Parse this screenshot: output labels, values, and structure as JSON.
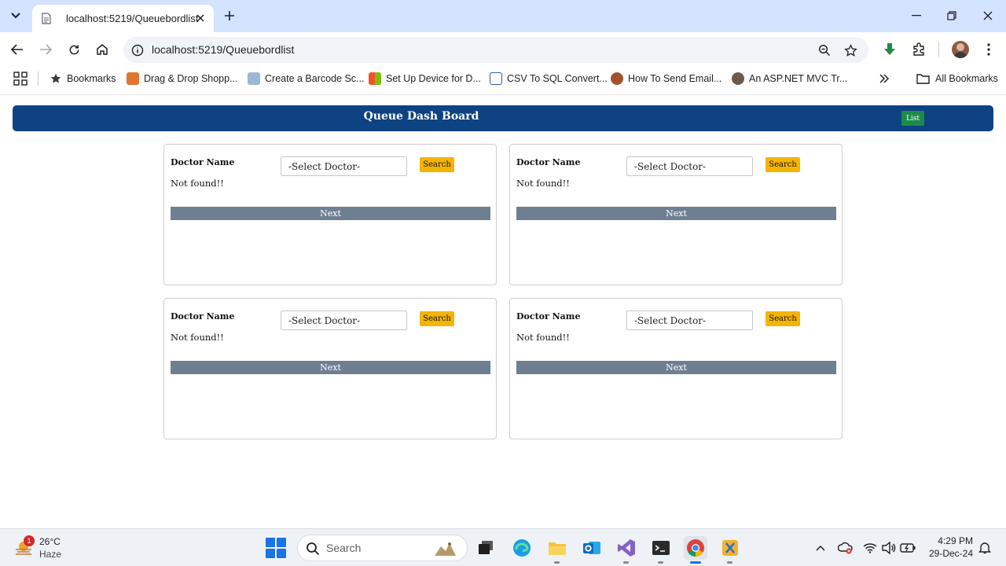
{
  "browser": {
    "tab_title": "localhost:5219/Queuebordlist",
    "url": "localhost:5219/Queuebordlist",
    "bookmarks_label": "Bookmarks",
    "bookmarks": [
      {
        "label": "Drag & Drop Shopp...",
        "color": "#e0752d"
      },
      {
        "label": "Create a Barcode Sc...",
        "color": "#9db7d8"
      },
      {
        "label": "Set Up Device for D...",
        "color": "#f35325"
      },
      {
        "label": "CSV To SQL Convert...",
        "color": "#2b5fb4"
      },
      {
        "label": "How To Send Email...",
        "color": "#a0522d"
      },
      {
        "label": "An ASP.NET MVC Tr...",
        "color": "#6d5a4a"
      }
    ],
    "all_bookmarks_label": "All Bookmarks"
  },
  "page": {
    "title": "Queue Dash Board",
    "list_button": "List",
    "colors": {
      "header": "#0d4382",
      "list_button": "#1e8a4a",
      "search_button": "#f4b400",
      "next_bar": "#6f7f92"
    },
    "cards": [
      {
        "label": "Doctor Name",
        "select_value": "-Select Doctor-",
        "search_label": "Search",
        "status": "Not found!!",
        "next_label": "Next"
      },
      {
        "label": "Doctor Name",
        "select_value": "-Select Doctor-",
        "search_label": "Search",
        "status": "Not found!!",
        "next_label": "Next"
      },
      {
        "label": "Doctor Name",
        "select_value": "-Select Doctor-",
        "search_label": "Search",
        "status": "Not found!!",
        "next_label": "Next"
      },
      {
        "label": "Doctor Name",
        "select_value": "-Select Doctor-",
        "search_label": "Search",
        "status": "Not found!!",
        "next_label": "Next"
      }
    ]
  },
  "taskbar": {
    "weather_temp": "26°C",
    "weather_desc": "Haze",
    "weather_badge": "1",
    "search_placeholder": "Search",
    "time": "4:29 PM",
    "date": "29-Dec-24"
  }
}
